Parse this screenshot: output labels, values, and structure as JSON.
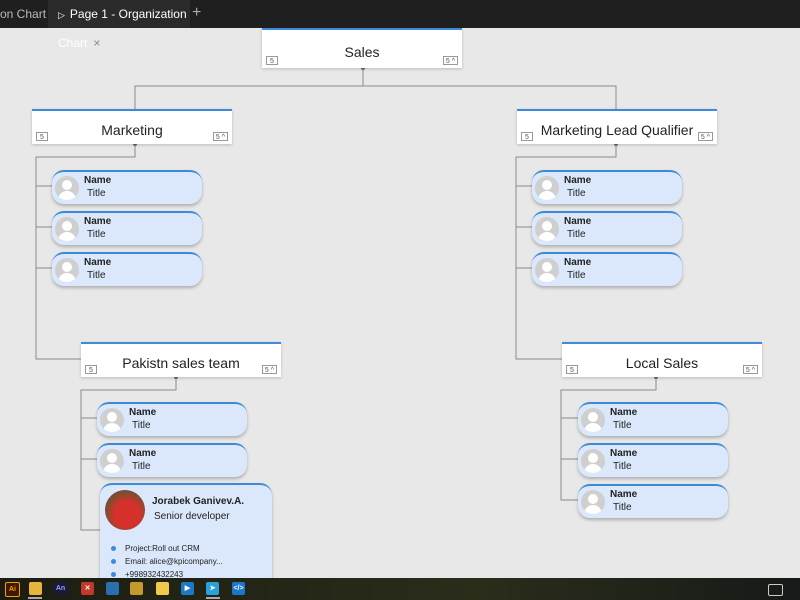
{
  "tabs": {
    "first_label": "on Chart",
    "active_label": "Page 1 - Organization Chart",
    "close_glyph": "×",
    "new_tab_glyph": "+"
  },
  "nodes": {
    "sales": {
      "label": "Sales",
      "badge_left": "5",
      "badge_right": "5 ^"
    },
    "marketing": {
      "label": "Marketing",
      "badge_left": "5",
      "badge_right": "5 ^"
    },
    "mlq": {
      "label": "Marketing Lead Qualifier",
      "badge_left": "5",
      "badge_right": "5 ^"
    },
    "pakistan": {
      "label": "Pakistn sales team",
      "badge_left": "5",
      "badge_right": "5 ^"
    },
    "local": {
      "label": "Local Sales",
      "badge_left": "5",
      "badge_right": "5 ^"
    }
  },
  "placeholder": {
    "name": "Name",
    "title": "Title"
  },
  "featured_person": {
    "name": "Jorabek Ganivev.A.",
    "title": "Senior developer",
    "project": "Project:Roll out CRM",
    "email": "Email: alice@kpicompany...",
    "phone": "+998932432243"
  },
  "taskbar": {
    "icons": [
      "illustrator-icon",
      "file-explorer-icon",
      "animate-icon",
      "xd-icon",
      "photos-icon",
      "folder-icon",
      "sketch-icon",
      "video-icon",
      "telegram-icon",
      "vscode-icon"
    ]
  }
}
